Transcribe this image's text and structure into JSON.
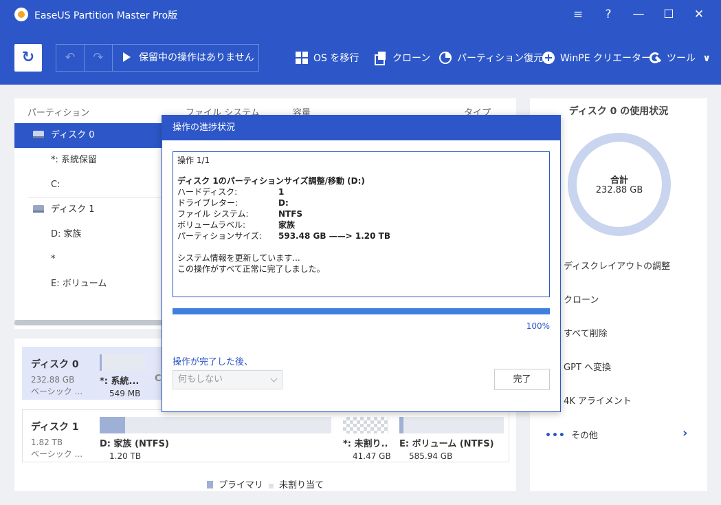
{
  "window": {
    "title": "EaseUS Partition Master Pro版",
    "buttons": {
      "menu": "≡",
      "help": "?",
      "minimize": "—",
      "maximize": "☐",
      "close": "✕"
    }
  },
  "toolbar": {
    "refresh_icon": "↻",
    "undo_icon": "↶",
    "redo_icon": "↷",
    "pending_label": "保留中の操作はありません",
    "items": [
      {
        "label": "OS を移行",
        "icon": "windows-icon"
      },
      {
        "label": "クローン",
        "icon": "clone-icon"
      },
      {
        "label": "パーティション復元",
        "icon": "pie-icon"
      },
      {
        "label": "WinPE クリエーター",
        "icon": "plus-icon"
      },
      {
        "label": "ツール",
        "icon": "wrench-icon"
      }
    ],
    "tools_caret": "∨"
  },
  "partition_table": {
    "columns": [
      "パーティション",
      "ファイル システム",
      "容量",
      "タイプ"
    ],
    "rows": [
      {
        "label": "ディスク 0",
        "is_disk": true,
        "selected": true
      },
      {
        "label": "*: 系統保留"
      },
      {
        "label": "C:"
      },
      {
        "label": "ディスク 1",
        "is_disk": true
      },
      {
        "label": "D: 家族"
      },
      {
        "label": "*"
      },
      {
        "label": "E: ボリューム"
      }
    ]
  },
  "disk_map": {
    "disks": [
      {
        "name": "ディスク 0",
        "size": "232.88 GB",
        "type": "ベーシック ...",
        "partitions": [
          {
            "name": "*: 系統...",
            "size": "549 MB",
            "used_fraction": 0.05
          },
          {
            "name": "C",
            "size": "",
            "used_fraction": 0
          }
        ]
      },
      {
        "name": "ディスク 1",
        "size": "1.82 TB",
        "type": "ベーシック ...",
        "partitions": [
          {
            "name": "D: 家族 (NTFS)",
            "size": "1.20 TB",
            "used_fraction": 0.11
          },
          {
            "name": "*: 未割り...",
            "size": "41.47 GB",
            "unallocated": true
          },
          {
            "name": "E: ボリューム (NTFS)",
            "size": "585.94 GB",
            "used_fraction": 0.04
          }
        ]
      }
    ],
    "legend": {
      "primary": "プライマリ",
      "unallocated": "未割り当て",
      "primary_color": "#9fb0d6",
      "unallocated_color": "#d5d8de"
    }
  },
  "usage_panel": {
    "title": "ディスク 0 の使用状況",
    "total_label": "合計",
    "total_value": "232.88 GB",
    "actions": [
      "ディスクレイアウトの調整",
      "クローン",
      "すべて削除",
      "GPT へ変換",
      "4K アライメント"
    ],
    "more_label": "その他",
    "more_dots": "•••",
    "more_chevron": "›"
  },
  "dialog": {
    "title": "操作の進捗状況",
    "log": {
      "step": "操作 1/1",
      "operation": "ディスク 1のパーティションサイズ調整/移動 (D:)",
      "details": [
        {
          "key": "ハードディスク:",
          "value": "1"
        },
        {
          "key": "ドライブレター:",
          "value": "D:"
        },
        {
          "key": "ファイル システム:",
          "value": "NTFS"
        },
        {
          "key": "ボリュームラベル:",
          "value": "家族"
        },
        {
          "key": "パーティションサイズ:",
          "value": "593.48 GB ——> 1.20 TB"
        }
      ],
      "messages": [
        "システム情報を更新しています...",
        "この操作がすべて正常に完了しました。"
      ]
    },
    "progress_percent": 100,
    "progress_label": "100%",
    "after_label": "操作が完了した後、",
    "after_select_value": "何もしない",
    "done_label": "完了",
    "accent_color": "#2d57c8"
  }
}
